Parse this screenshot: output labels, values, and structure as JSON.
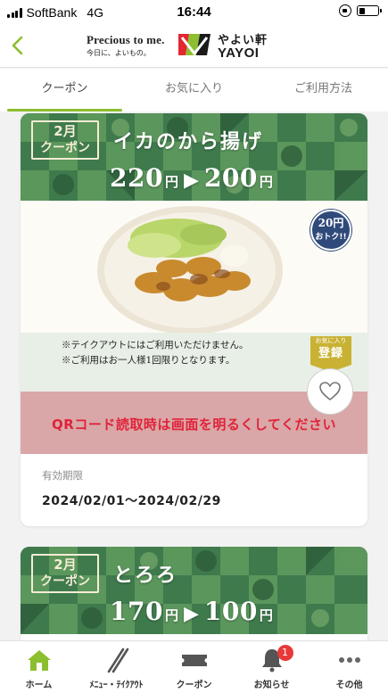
{
  "status_bar": {
    "carrier": "SoftBank",
    "network": "4G",
    "time": "16:44"
  },
  "header": {
    "tagline": "Precious to me.",
    "tagline_sub": "今日に、よいもの。",
    "brand_jp": "やよい軒",
    "brand_en": "YAYOI"
  },
  "tabs": [
    {
      "label": "クーポン",
      "active": true
    },
    {
      "label": "お気に入り",
      "active": false
    },
    {
      "label": "ご利用方法",
      "active": false
    }
  ],
  "coupons": [
    {
      "month": "2月",
      "coupon_label": "クーポン",
      "item": "イカのから揚げ",
      "old_price": "220",
      "new_price": "200",
      "yen": "円",
      "arrow": "▶",
      "discount_value": "20円",
      "discount_label": "おトク!!",
      "notes": [
        "※テイクアウトにはご利用いただけません。",
        "※ご利用はお一人様1回限りとなります。"
      ],
      "register_small": "お気に入り",
      "register_label": "登録",
      "qr_notice": "QRコード読取時は画面を明るくしてください",
      "validity_label": "有効期限",
      "validity_value": "2024/02/01〜2024/02/29"
    },
    {
      "month": "2月",
      "coupon_label": "クーポン",
      "item": "とろろ",
      "old_price": "170",
      "new_price": "100",
      "yen": "円",
      "arrow": "▶"
    }
  ],
  "bottom_nav": [
    {
      "label": "ホーム",
      "icon": "home-icon",
      "active": true
    },
    {
      "label": "ﾒﾆｭｰ・ﾃｲｸｱｳﾄ",
      "icon": "chopsticks-icon",
      "active": false
    },
    {
      "label": "クーポン",
      "icon": "ticket-icon",
      "active": false
    },
    {
      "label": "お知らせ",
      "icon": "bell-icon",
      "badge": "1",
      "active": false
    },
    {
      "label": "その他",
      "icon": "more-icon",
      "active": false
    }
  ],
  "colors": {
    "accent_green": "#8cbf2f",
    "banner_green": "#3f7a4d",
    "qr_bg": "#d9a7a7",
    "qr_text": "#e0233a",
    "badge_red": "#e8393a"
  }
}
